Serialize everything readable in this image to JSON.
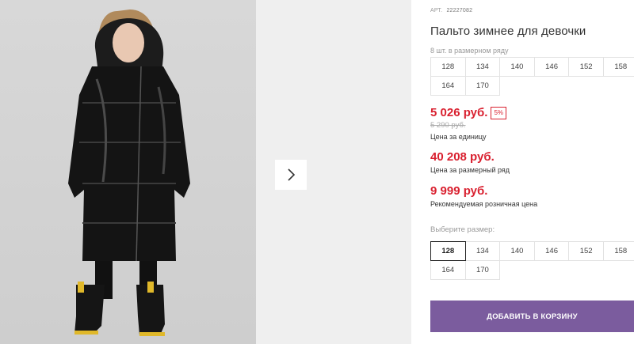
{
  "product": {
    "art_label": "АРТ.",
    "art_value": "22227082",
    "title": "Пальто зимнее для девочки",
    "pack_note": "8 шт. в размерном ряду",
    "pack_sizes": [
      "128",
      "134",
      "140",
      "146",
      "152",
      "158",
      "164",
      "170"
    ],
    "price": "5 026 руб.",
    "discount": "5%",
    "old_price": "5 290 руб.",
    "unit_price_note": "Цена за единицу",
    "set_price": "40 208 руб.",
    "set_price_note": "Цена за размерный ряд",
    "rrp": "9 999 руб.",
    "rrp_note": "Рекомендуемая розничная цена",
    "choose_size_label": "Выберите размер:",
    "sizes": [
      "128",
      "134",
      "140",
      "146",
      "152",
      "158",
      "164",
      "170"
    ],
    "selected_size": "128",
    "add_to_cart": "ДОБАВИТЬ В КОРЗИНУ"
  },
  "colors": {
    "accent": "#7b5c9e",
    "price_red": "#d9202f"
  },
  "gallery": {
    "next_icon": "chevron-right-icon"
  }
}
